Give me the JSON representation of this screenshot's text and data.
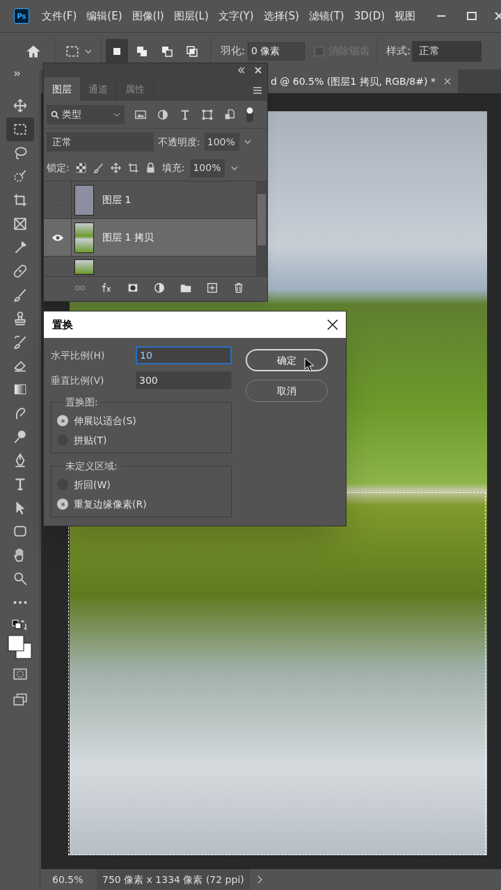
{
  "menu_bar": {
    "logo": "Ps",
    "items": [
      "文件(F)",
      "编辑(E)",
      "图像(I)",
      "图层(L)",
      "文字(Y)",
      "选择(S)",
      "滤镜(T)",
      "3D(D)",
      "视图"
    ]
  },
  "options_bar": {
    "modes": [
      {
        "selected": true
      },
      {
        "selected": false
      },
      {
        "selected": false
      },
      {
        "selected": false
      }
    ],
    "feather_label": "羽化:",
    "feather_value": "0 像素",
    "antialias": {
      "label": "消除锯齿",
      "checked": false,
      "disabled": true
    },
    "style_label": "样式:",
    "style_value": "正常"
  },
  "tools": [
    {
      "kind": "move",
      "selected": false
    },
    {
      "kind": "marquee",
      "selected": true
    },
    {
      "kind": "lasso",
      "selected": false
    },
    {
      "kind": "quickselect",
      "selected": false
    },
    {
      "kind": "crop",
      "selected": false
    },
    {
      "kind": "frame",
      "selected": false
    },
    {
      "kind": "eyedropper",
      "selected": false
    },
    {
      "kind": "heal",
      "selected": false
    },
    {
      "kind": "brush",
      "selected": false
    },
    {
      "kind": "stamp",
      "selected": false
    },
    {
      "kind": "historybrush",
      "selected": false
    },
    {
      "kind": "eraser",
      "selected": false
    },
    {
      "kind": "gradient",
      "selected": false
    },
    {
      "kind": "smudge",
      "selected": false
    },
    {
      "kind": "dodge",
      "selected": false
    },
    {
      "kind": "pen",
      "selected": false
    },
    {
      "kind": "type",
      "selected": false
    },
    {
      "kind": "pathselect",
      "selected": false
    },
    {
      "kind": "shape",
      "selected": false
    },
    {
      "kind": "hand",
      "selected": false
    },
    {
      "kind": "zoom",
      "selected": false
    },
    {
      "kind": "more",
      "selected": false
    }
  ],
  "document_tab": {
    "title": "d @ 60.5% (图层1 拷贝, RGB/8#) *"
  },
  "layers_panel": {
    "tabs": [
      {
        "label": "图层",
        "selected": true
      },
      {
        "label": "通道",
        "selected": false
      },
      {
        "label": "属性",
        "selected": false
      }
    ],
    "filter": "类型",
    "blend_mode": "正常",
    "opacity_label": "不透明度:",
    "opacity": "100%",
    "lock_label": "锁定:",
    "fill_label": "填充:",
    "fill": "100%",
    "layers": [
      {
        "name": "图层 1",
        "visible": false,
        "selected": false,
        "kind": "solid"
      },
      {
        "name": "图层 1 拷贝",
        "visible": true,
        "selected": true,
        "kind": "photo"
      }
    ]
  },
  "dialog": {
    "title": "置换",
    "fields": [
      {
        "label": "水平比例(H)",
        "value": "10",
        "focused": true
      },
      {
        "label": "垂直比例(V)",
        "value": "300",
        "focused": false
      }
    ],
    "groups": [
      {
        "title": "置换图:",
        "options": [
          {
            "label": "伸展以适合(S)",
            "selected": true
          },
          {
            "label": "拼贴(T)",
            "selected": false
          }
        ]
      },
      {
        "title": "未定义区域:",
        "options": [
          {
            "label": "折回(W)",
            "selected": false
          },
          {
            "label": "重复边缘像素(R)",
            "selected": true
          }
        ]
      }
    ],
    "buttons": [
      {
        "label": "确定",
        "default": true
      },
      {
        "label": "取消",
        "default": false
      }
    ]
  },
  "status_bar": {
    "zoom": "60.5%",
    "info": "750 像素 x 1334 像素 (72 ppi)"
  }
}
